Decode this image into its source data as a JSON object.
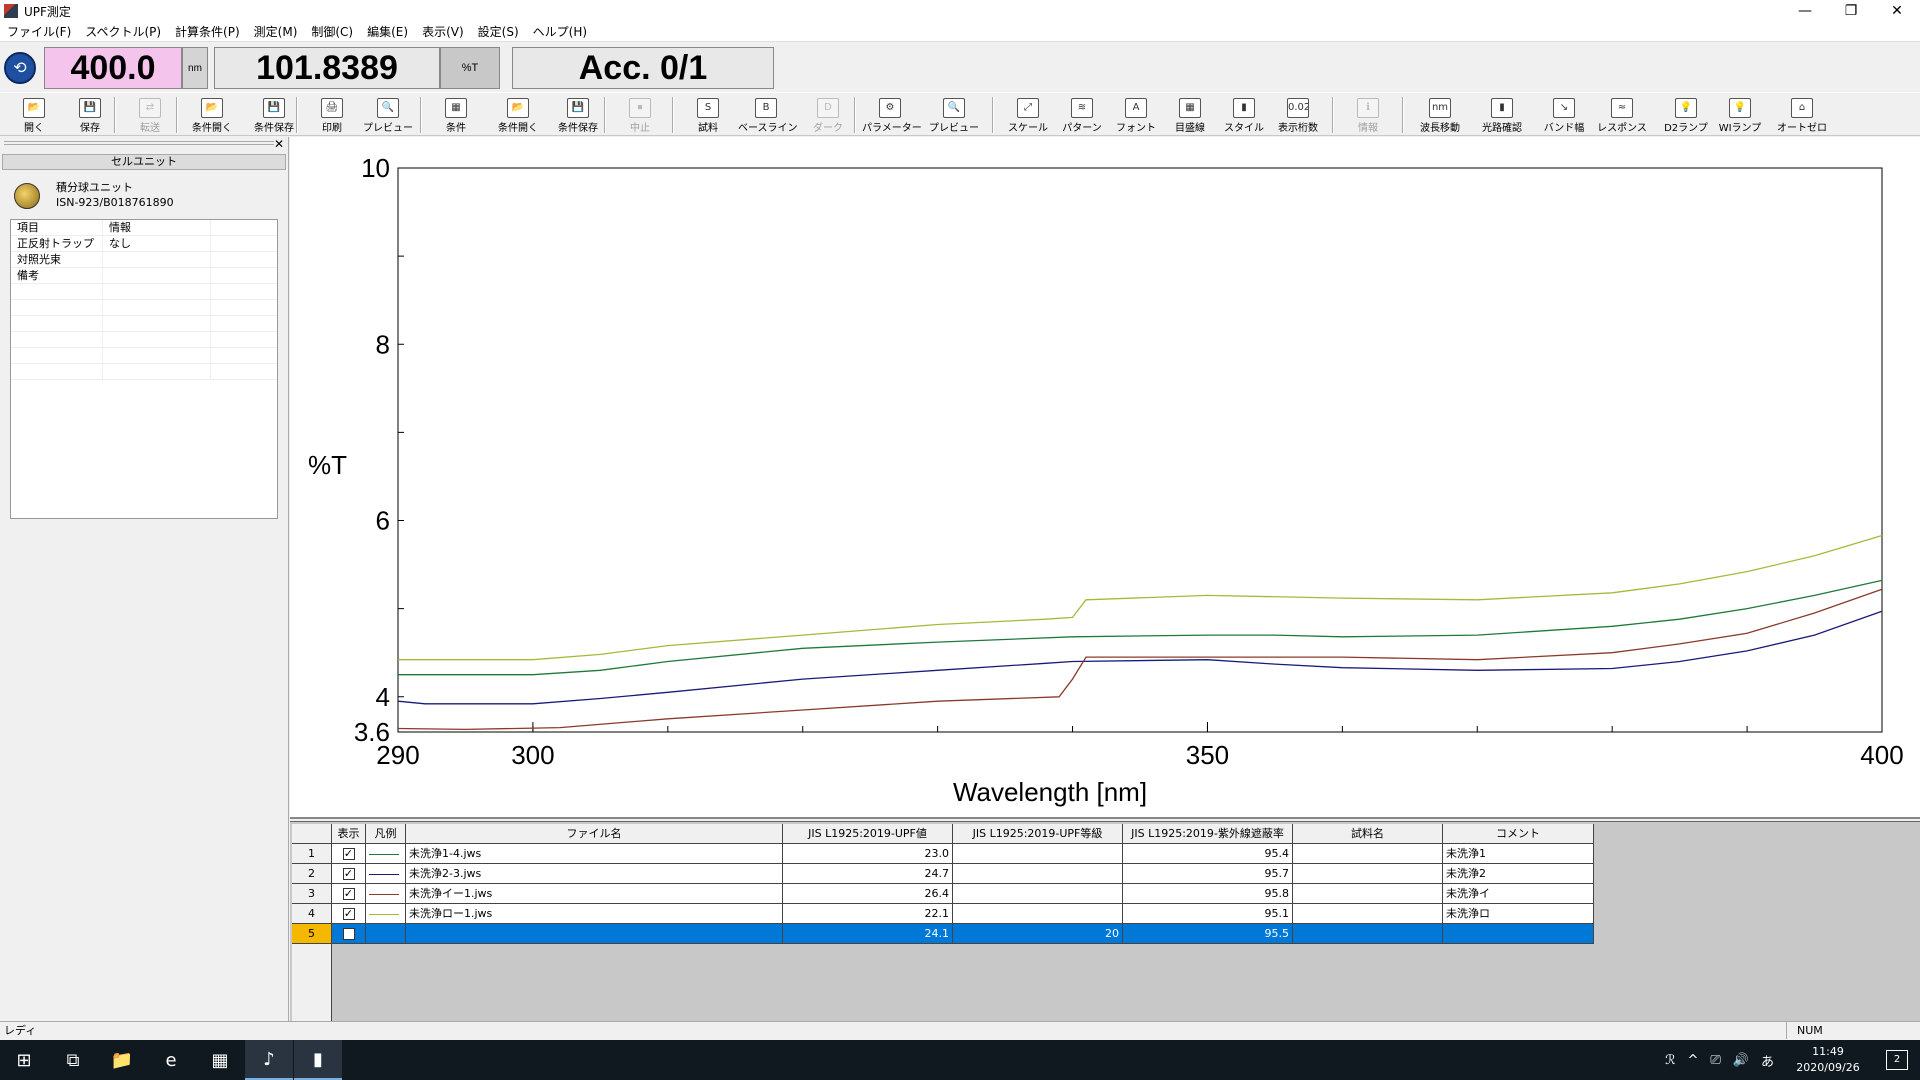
{
  "window": {
    "title": "UPF測定",
    "controls": [
      "—",
      "❐",
      "✕"
    ]
  },
  "menu": [
    "ファイル(F)",
    "スペクトル(P)",
    "計算条件(P)",
    "測定(M)",
    "制御(C)",
    "編集(E)",
    "表示(V)",
    "設定(S)",
    "ヘルプ(H)"
  ],
  "readout": {
    "wavelength": "400.0",
    "wavelength_unit": "nm",
    "value": "101.8389",
    "value_unit": "%T",
    "acc": "Acc. 0/1"
  },
  "toolbar": [
    {
      "label": "開く",
      "icon": "folder-open-icon",
      "glyph": "📂",
      "enabled": true
    },
    {
      "label": "保存",
      "icon": "save-icon",
      "glyph": "💾",
      "enabled": true
    },
    {
      "label": "転送",
      "icon": "transfer-icon",
      "glyph": "⇄",
      "enabled": false
    },
    {
      "label": "条件開く",
      "icon": "open-condition-icon",
      "glyph": "📂",
      "enabled": true
    },
    {
      "label": "条件保存",
      "icon": "save-condition-icon",
      "glyph": "💾",
      "enabled": true
    },
    {
      "label": "印刷",
      "icon": "print-icon",
      "glyph": "🖨",
      "enabled": true
    },
    {
      "label": "プレビュー",
      "icon": "preview-icon",
      "glyph": "🔍",
      "enabled": true
    },
    {
      "label": "条件",
      "icon": "condition-icon",
      "glyph": "▦",
      "enabled": true
    },
    {
      "label": "条件開く",
      "icon": "open-condition2-icon",
      "glyph": "📂",
      "enabled": true
    },
    {
      "label": "条件保存",
      "icon": "save-condition2-icon",
      "glyph": "💾",
      "enabled": true
    },
    {
      "label": "中止",
      "icon": "stop-icon",
      "glyph": "⏹",
      "enabled": false
    },
    {
      "label": "試料",
      "icon": "sample-icon",
      "glyph": "S",
      "enabled": true
    },
    {
      "label": "ベースライン",
      "icon": "baseline-icon",
      "glyph": "B",
      "enabled": true
    },
    {
      "label": "ダーク",
      "icon": "dark-icon",
      "glyph": "D",
      "enabled": false
    },
    {
      "label": "パラメーター",
      "icon": "parameter-icon",
      "glyph": "⚙",
      "enabled": true
    },
    {
      "label": "プレビュー",
      "icon": "preview2-icon",
      "glyph": "🔍",
      "enabled": true
    },
    {
      "label": "スケール",
      "icon": "scale-icon",
      "glyph": "⤢",
      "enabled": true
    },
    {
      "label": "パターン",
      "icon": "pattern-icon",
      "glyph": "≋",
      "enabled": true
    },
    {
      "label": "フォント",
      "icon": "font-icon",
      "glyph": "A",
      "enabled": true
    },
    {
      "label": "目盛線",
      "icon": "gridline-icon",
      "glyph": "▦",
      "enabled": true
    },
    {
      "label": "スタイル",
      "icon": "style-icon",
      "glyph": "▮",
      "enabled": true
    },
    {
      "label": "表示桁数",
      "icon": "digits-icon",
      "glyph": "0.023",
      "enabled": true
    },
    {
      "label": "情報",
      "icon": "info-icon",
      "glyph": "ℹ",
      "enabled": false
    },
    {
      "label": "波長移動",
      "icon": "wavelength-move-icon",
      "glyph": "nm",
      "enabled": true
    },
    {
      "label": "光路確認",
      "icon": "lightpath-icon",
      "glyph": "▮",
      "enabled": true
    },
    {
      "label": "バンド幅",
      "icon": "bandwidth-icon",
      "glyph": "↘",
      "enabled": true
    },
    {
      "label": "レスポンス",
      "icon": "response-icon",
      "glyph": "≈",
      "enabled": true
    },
    {
      "label": "D2ランプ",
      "icon": "d2-lamp-icon",
      "glyph": "💡",
      "enabled": true
    },
    {
      "label": "WIランプ",
      "icon": "wi-lamp-icon",
      "glyph": "💡",
      "enabled": true
    },
    {
      "label": "オートゼロ",
      "icon": "autozero-icon",
      "glyph": "⌂",
      "enabled": true
    }
  ],
  "left_panel": {
    "header": "セルユニット",
    "close": "✕",
    "unit_name": "積分球ユニット",
    "unit_model": "ISN-923/B018761890",
    "table_header": [
      "項目",
      "情報"
    ],
    "rows": [
      [
        "正反射トラップ",
        "なし"
      ],
      [
        "対照光束",
        ""
      ],
      [
        "備考",
        ""
      ]
    ]
  },
  "chart_data": {
    "type": "line",
    "xlabel": "Wavelength [nm]",
    "ylabel": "%T",
    "xlim": [
      290,
      400
    ],
    "ylim": [
      3.6,
      10
    ],
    "xticks": [
      290,
      300,
      350,
      400
    ],
    "yticks": [
      3.6,
      4,
      6,
      8,
      10
    ],
    "grid": false,
    "series": [
      {
        "name": "未洗浄1-4.jws",
        "color": "#1f7a3a",
        "x": [
          290,
          300,
          305,
          310,
          320,
          330,
          340,
          350,
          355,
          360,
          370,
          380,
          385,
          390,
          395,
          400
        ],
        "y": [
          4.25,
          4.25,
          4.3,
          4.4,
          4.55,
          4.62,
          4.68,
          4.7,
          4.7,
          4.68,
          4.7,
          4.8,
          4.88,
          5.0,
          5.15,
          5.32
        ]
      },
      {
        "name": "未洗浄2-3.jws",
        "color": "#1a1a7a",
        "x": [
          290,
          292,
          300,
          305,
          310,
          320,
          330,
          338,
          340,
          350,
          355,
          360,
          370,
          380,
          385,
          390,
          395,
          400
        ],
        "y": [
          3.95,
          3.92,
          3.92,
          3.98,
          4.05,
          4.2,
          4.3,
          4.38,
          4.4,
          4.42,
          4.37,
          4.33,
          4.3,
          4.32,
          4.4,
          4.52,
          4.7,
          4.97
        ]
      },
      {
        "name": "未洗浄イ-1.jws",
        "color": "#8a3a2a",
        "x": [
          290,
          295,
          302,
          310,
          320,
          330,
          339,
          340,
          341,
          350,
          360,
          370,
          380,
          385,
          390,
          395,
          400
        ],
        "y": [
          3.64,
          3.63,
          3.65,
          3.75,
          3.85,
          3.95,
          4.0,
          4.2,
          4.45,
          4.45,
          4.45,
          4.42,
          4.5,
          4.6,
          4.72,
          4.95,
          5.22
        ]
      },
      {
        "name": "未洗浄ロ-1.jws",
        "color": "#a8b83a",
        "x": [
          290,
          300,
          305,
          310,
          320,
          330,
          338,
          340,
          341,
          350,
          360,
          370,
          380,
          385,
          390,
          395,
          400
        ],
        "y": [
          4.42,
          4.42,
          4.48,
          4.58,
          4.7,
          4.82,
          4.88,
          4.9,
          5.1,
          5.15,
          5.12,
          5.1,
          5.18,
          5.28,
          5.42,
          5.6,
          5.83
        ]
      }
    ]
  },
  "data_table": {
    "headers": [
      "",
      "表示",
      "凡例",
      "ファイル名",
      "JIS L1925:2019-UPF値",
      "JIS L1925:2019-UPF等級",
      "JIS L1925:2019-紫外線遮蔽率",
      "試料名",
      "コメント"
    ],
    "rows": [
      {
        "num": "1",
        "checked": true,
        "color": "#1f7a3a",
        "file": "未洗浄1-4.jws",
        "upf": "23.0",
        "grade": "",
        "block": "95.4",
        "sample": "",
        "comment": "未洗浄1"
      },
      {
        "num": "2",
        "checked": true,
        "color": "#1a1a7a",
        "file": "未洗浄2-3.jws",
        "upf": "24.7",
        "grade": "",
        "block": "95.7",
        "sample": "",
        "comment": "未洗浄2"
      },
      {
        "num": "3",
        "checked": true,
        "color": "#8a3a2a",
        "file": "未洗浄イー1.jws",
        "upf": "26.4",
        "grade": "",
        "block": "95.8",
        "sample": "",
        "comment": "未洗浄イ"
      },
      {
        "num": "4",
        "checked": true,
        "color": "#a8b83a",
        "file": "未洗浄ロー1.jws",
        "upf": "22.1",
        "grade": "",
        "block": "95.1",
        "sample": "",
        "comment": "未洗浄ロ"
      },
      {
        "num": "5",
        "checked": false,
        "color": "",
        "file": "",
        "upf": "24.1",
        "grade": "20",
        "block": "95.5",
        "sample": "",
        "comment": "",
        "selected": true
      }
    ]
  },
  "status": {
    "text": "レディ",
    "num": "NUM"
  },
  "taskbar": {
    "items": [
      {
        "icon": "windows-start-icon",
        "glyph": "⊞"
      },
      {
        "icon": "task-view-icon",
        "glyph": "⧉"
      },
      {
        "icon": "file-explorer-icon",
        "glyph": "📁"
      },
      {
        "icon": "internet-explorer-icon",
        "glyph": "e"
      },
      {
        "icon": "calculator-icon",
        "glyph": "▦"
      },
      {
        "icon": "upf-app-icon",
        "glyph": "♪"
      },
      {
        "icon": "spectra-manager-icon",
        "glyph": "▮"
      }
    ],
    "tray": [
      "ℛ",
      "^",
      "⎚",
      "🔊",
      "あ"
    ],
    "time": "11:49",
    "date": "2020/09/26",
    "notify": "2"
  }
}
